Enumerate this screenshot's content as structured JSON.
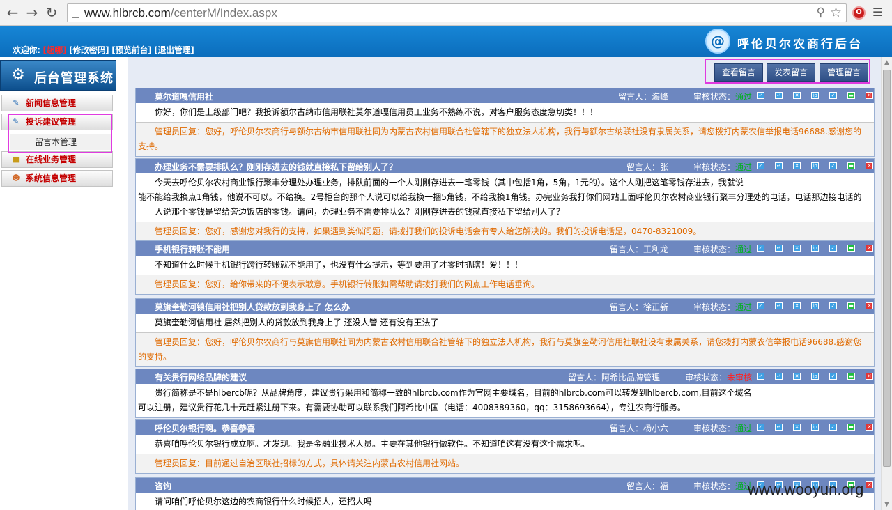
{
  "browser": {
    "url_host": "www.hlbrcb.com",
    "url_path": "/centerM/Index.aspx"
  },
  "header": {
    "welcome_label": "欢迎你:",
    "username": "[超哪]",
    "links": [
      "[修改密码]",
      "[预览前台]",
      "[退出管理]"
    ],
    "logo_text": "呼伦贝尔农商行后台"
  },
  "sidebar": {
    "system_title": "后台管理系统",
    "menu": [
      "新闻信息管理",
      "投诉建议管理",
      "在线业务管理",
      "系统信息管理"
    ],
    "submenu": [
      "留言本管理"
    ]
  },
  "toolbar": {
    "buttons": [
      "查看留言",
      "发表留言",
      "管理留言"
    ]
  },
  "labels": {
    "author_prefix": "留言人：",
    "status_prefix": "审核状态："
  },
  "messages": [
    {
      "title": "莫尔道嘎信用社",
      "author": "海峰",
      "status": "通过",
      "body": "你好，你们是上级部门吧？我投诉额尔古纳市信用联社莫尔道嘎信用员工业务不熟练不说，对客户服务态度急切类！！！",
      "body_tail": "",
      "reply": "管理员回复：您好，呼伦贝尔农商行与额尔古纳市信用联社同为内蒙古农村信用联合社管辖下的独立法人机构，我行与额尔古纳联社没有隶属关系，请您拨打内蒙农信举报电话96688.感谢您的",
      "reply_tail": "支持。"
    },
    {
      "title": "办理业务不需要排队么？刚刚存进去的钱就直接私下留给别人了？",
      "author": "张",
      "status": "通过",
      "body": "今天去呼伦贝尔农村商业银行聚丰分理处办理业务，排队前面的一个人刚刚存进去一笔零钱（其中包括1角，5角，1元的）。这个人刚把这笔零钱存进去，我就说",
      "body_tail": "能不能给我换点1角钱，他说不可以。不给换。2号柜台的那个人说可以给我换一捆5角钱，不给我换1角钱。办完业务我打你们网站上面呼伦贝尔农村商业银行聚丰分理处的电话，电话那边接电话的人说那个零钱是留给旁边饭店的零钱。请问，办理业务不需要排队么？刚刚存进去的钱就直接私下留给别人了？",
      "reply": "管理员回复：您好，感谢您对我行的支持，如果遇到类似问题，请拨打我们的投诉电话会有专人给您解决的。我们的投诉电话是，0470-8321009。",
      "reply_tail": ""
    },
    {
      "title": "手机银行转账不能用",
      "author": "王利龙",
      "status": "通过",
      "body": "不知道什么时候手机银行跨行转账就不能用了，也没有什么提示，等到要用了才零时抓瞎！爱！！！",
      "body_tail": "",
      "reply": "管理员回复：您好，给你带来的不便表示歉意。手机银行转账如需帮助请拨打我们的网点工作电话垂询。",
      "reply_tail": ""
    },
    {
      "title": "莫旗奎勒河镇信用社把别人贷款放到我身上了 怎么办",
      "author": "徐正新",
      "status": "通过",
      "body": "莫旗奎勒河信用社 居然把别人的贷款放到我身上了 还没人管 还有没有王法了",
      "body_tail": "",
      "reply": "管理员回复：您好，呼伦贝尔农商行与莫旗信用联社同为内蒙古农村信用联合社管辖下的独立法人机构，我行与莫旗奎勒河信用社联社没有隶属关系，请您拨打内蒙农信举报电话96688.感谢您",
      "reply_tail": "的支持。"
    },
    {
      "title": "有关贵行网络品牌的建议",
      "author": "阿希比品牌管理",
      "status": "未审核",
      "body": "贵行简称是不是hlbercb呢？从品牌角度，建议贵行采用和简称一致的hlbrcb.com作为官网主要域名，目前的hlbrcb.com可以转发到hlbercb.com,目前这个域名",
      "body_tail": "可以注册，建议贵行花几十元赶紧注册下来。有需要协助可以联系我们阿希比中国（电话：4008389360，qq：3158693664），专注农商行服务。",
      "reply": "",
      "reply_tail": ""
    },
    {
      "title": "呼伦贝尔银行啊。恭喜恭喜",
      "author": "杨小六",
      "status": "通过",
      "body": "恭喜咱呼伦贝尔银行成立啊。才发现。我是金融业技术人员。主要在其他银行做软件。不知道咱这有没有这个需求呢。",
      "body_tail": "",
      "reply": "管理员回复：目前通过自治区联社招标的方式，具体请关注内蒙古农村信用社网站。",
      "reply_tail": ""
    },
    {
      "title": "咨询",
      "author": "福",
      "status": "通过",
      "body": "请问咱们呼伦贝尔这边的农商银行什么时候招人，还招人吗",
      "body_tail": "",
      "reply": "",
      "reply_tail": ""
    }
  ],
  "action_icons": [
    "view-icon",
    "edit-icon",
    "delete-mark-icon",
    "ip-icon",
    "approve-icon",
    "toggle-icon",
    "delete-icon"
  ],
  "colors": {
    "header_blue": "#0b6dbc",
    "row_header": "#6d87c0",
    "reply_orange": "#e06a00",
    "status_ok": "#00b020",
    "status_pending": "#ff2020",
    "highlight": "#e03be0"
  },
  "watermark": "www.wooyun.org"
}
